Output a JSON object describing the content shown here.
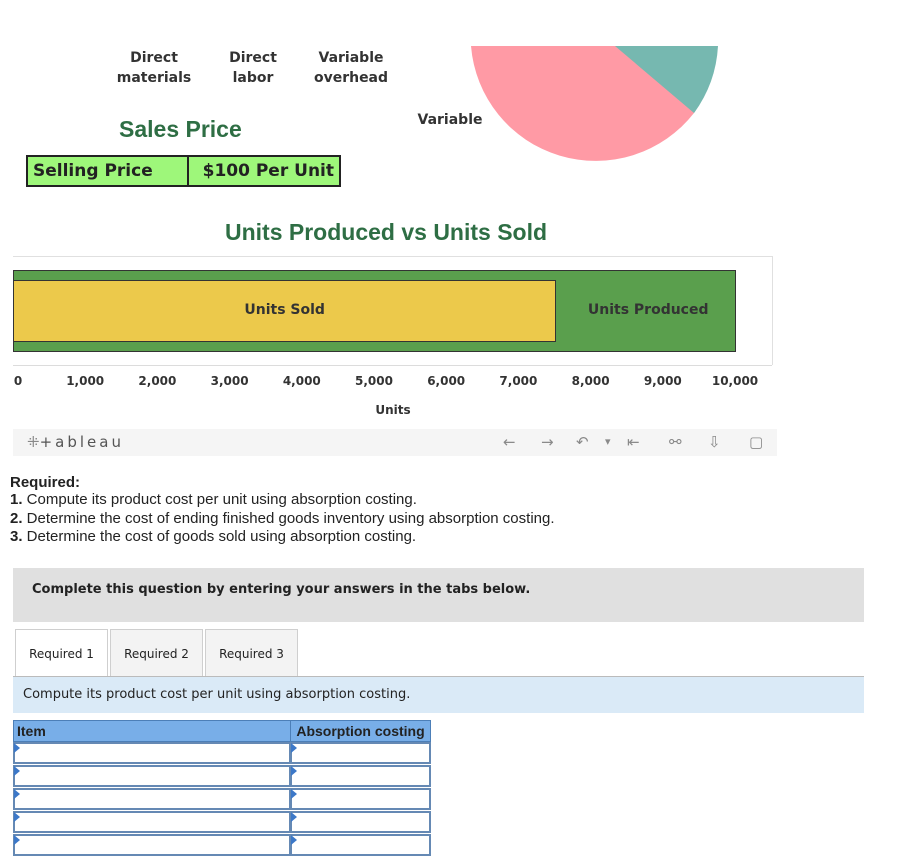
{
  "legend": {
    "items": [
      "Direct\nmaterials",
      "Direct labor",
      "Variable\noverhead"
    ]
  },
  "pie": {
    "label": "Variable",
    "colors": [
      "#ff9aa5",
      "#76b8b0"
    ]
  },
  "sales_price": {
    "title": "Sales Price",
    "label": "Selling Price",
    "value": "$100 Per Unit",
    "cell_color": "#9ef77a"
  },
  "chart_data": {
    "type": "bar",
    "title": "Units Produced vs Units Sold",
    "orientation": "horizontal",
    "xlabel": "Units",
    "xlim": [
      0,
      10000
    ],
    "x_ticks": [
      "0",
      "1,000",
      "2,000",
      "3,000",
      "4,000",
      "5,000",
      "6,000",
      "7,000",
      "8,000",
      "9,000",
      "10,000"
    ],
    "series": [
      {
        "name": "Units Produced",
        "value": 10000,
        "color": "#5a9f4d"
      },
      {
        "name": "Units Sold",
        "value": 7500,
        "color": "#ecc94b"
      }
    ]
  },
  "toolbar": {
    "logo": "+ableau",
    "icons": [
      "undo-icon",
      "redo-icon",
      "revert-icon",
      "dropdown-icon",
      "reset-icon",
      "share-icon",
      "download-icon",
      "fullscreen-icon"
    ],
    "glyphs": [
      "←",
      "→",
      "↶",
      "▾",
      "⇤",
      "⚯",
      "⇩",
      "▢"
    ]
  },
  "question": {
    "heading": "Required:",
    "items": [
      {
        "num": "1.",
        "text": " Compute its product cost per unit using absorption costing."
      },
      {
        "num": "2.",
        "text": " Determine the cost of ending finished goods inventory using absorption costing."
      },
      {
        "num": "3.",
        "text": " Determine the cost of goods sold using absorption costing."
      }
    ]
  },
  "instruction": "Complete this question by entering your answers in the tabs below.",
  "tabs": [
    "Required 1",
    "Required 2",
    "Required 3"
  ],
  "prompt": "Compute its product cost per unit using absorption costing.",
  "table": {
    "headers": [
      "Item",
      "Absorption costing"
    ],
    "rows": [
      [
        "",
        ""
      ],
      [
        "",
        ""
      ],
      [
        "",
        ""
      ],
      [
        "",
        ""
      ],
      [
        "",
        ""
      ]
    ]
  }
}
